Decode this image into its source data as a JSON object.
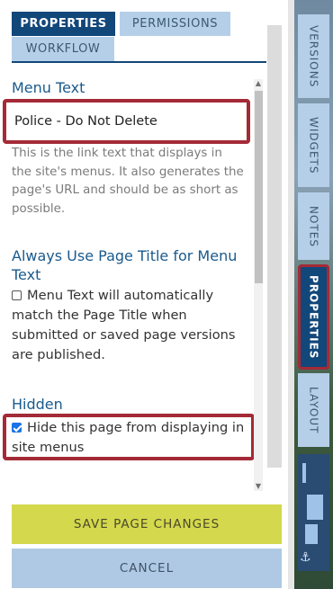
{
  "tabs": {
    "properties": "PROPERTIES",
    "permissions": "PERMISSIONS",
    "workflow": "WORKFLOW"
  },
  "menu_text": {
    "title": "Menu Text",
    "value": "Police - Do Not Delete",
    "help": "This is the link text that displays in the site's menus. It also generates the page's URL and should be as short as possible."
  },
  "always_use_title": {
    "title": "Always Use Page Title for Menu Text",
    "checkbox_label": "Menu Text will automatically match the Page Title when submitted or saved page versions are published.",
    "checked": false
  },
  "hidden": {
    "title": "Hidden",
    "checkbox_label": "Hide this page from displaying in site menus",
    "checked": true
  },
  "buttons": {
    "save": "SAVE PAGE CHANGES",
    "cancel": "CANCEL"
  },
  "side_tabs": {
    "versions": "VERSIONS",
    "widgets": "WIDGETS",
    "notes": "NOTES",
    "properties": "PROPERTIES",
    "layout": "LAYOUT"
  },
  "colors": {
    "accent_dark": "#12477a",
    "tab_light": "#b5cfe9",
    "save_button": "#d4d84d",
    "highlight": "#a32a36"
  }
}
